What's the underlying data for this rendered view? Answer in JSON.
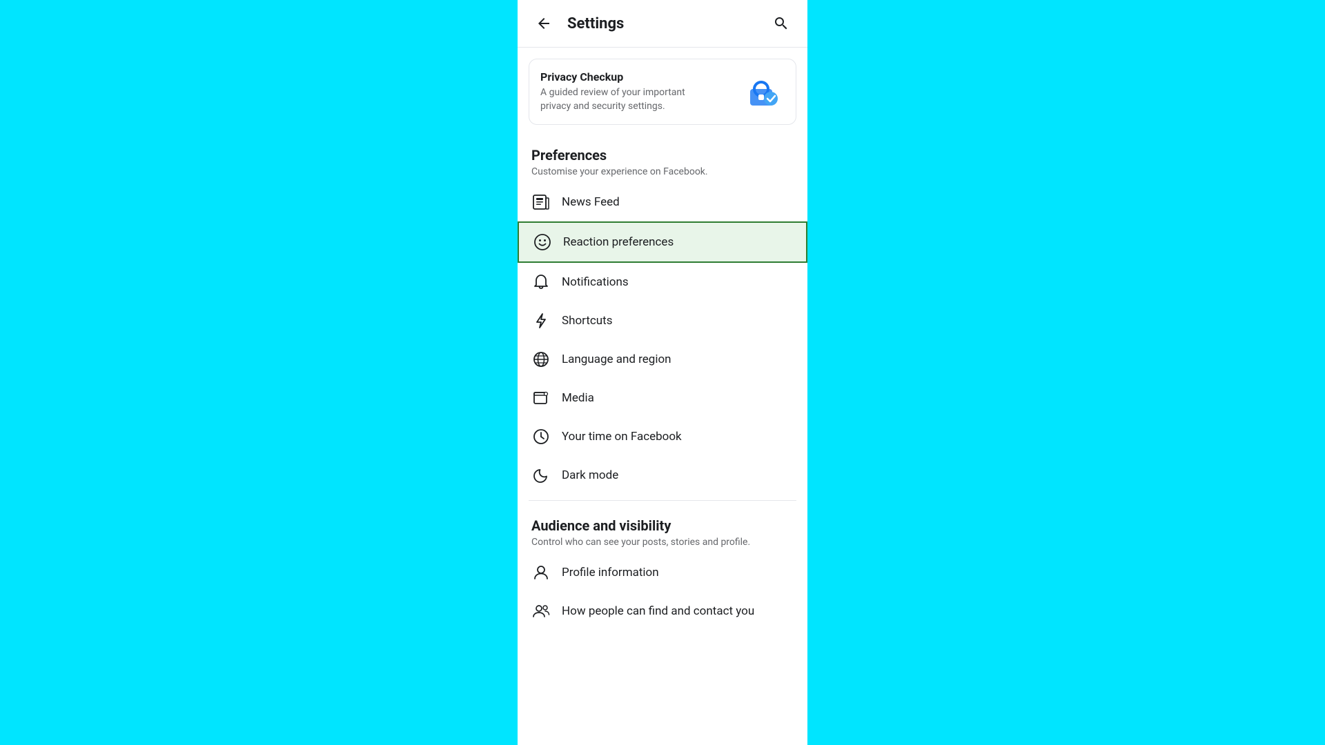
{
  "header": {
    "title": "Settings",
    "back_icon": "back-arrow",
    "search_icon": "search"
  },
  "privacy_checkup": {
    "title": "Privacy Checkup",
    "description": "A guided review of your important privacy and security settings."
  },
  "preferences": {
    "section_title": "Preferences",
    "section_subtitle": "Customise your experience on Facebook.",
    "items": [
      {
        "id": "news-feed",
        "label": "News Feed",
        "icon": "newspaper",
        "active": false
      },
      {
        "id": "reaction-preferences",
        "label": "Reaction preferences",
        "icon": "emoji",
        "active": true
      },
      {
        "id": "notifications",
        "label": "Notifications",
        "icon": "bell",
        "active": false
      },
      {
        "id": "shortcuts",
        "label": "Shortcuts",
        "icon": "lightning",
        "active": false
      },
      {
        "id": "language-region",
        "label": "Language and region",
        "icon": "globe",
        "active": false
      },
      {
        "id": "media",
        "label": "Media",
        "icon": "media",
        "active": false
      },
      {
        "id": "your-time",
        "label": "Your time on Facebook",
        "icon": "clock",
        "active": false
      },
      {
        "id": "dark-mode",
        "label": "Dark mode",
        "icon": "moon",
        "active": false
      }
    ]
  },
  "audience": {
    "section_title": "Audience and visibility",
    "section_subtitle": "Control who can see your posts, stories and profile.",
    "items": [
      {
        "id": "profile-information",
        "label": "Profile information",
        "icon": "person",
        "active": false
      },
      {
        "id": "how-people-find",
        "label": "How people can find and contact you",
        "icon": "people",
        "active": false
      }
    ]
  }
}
